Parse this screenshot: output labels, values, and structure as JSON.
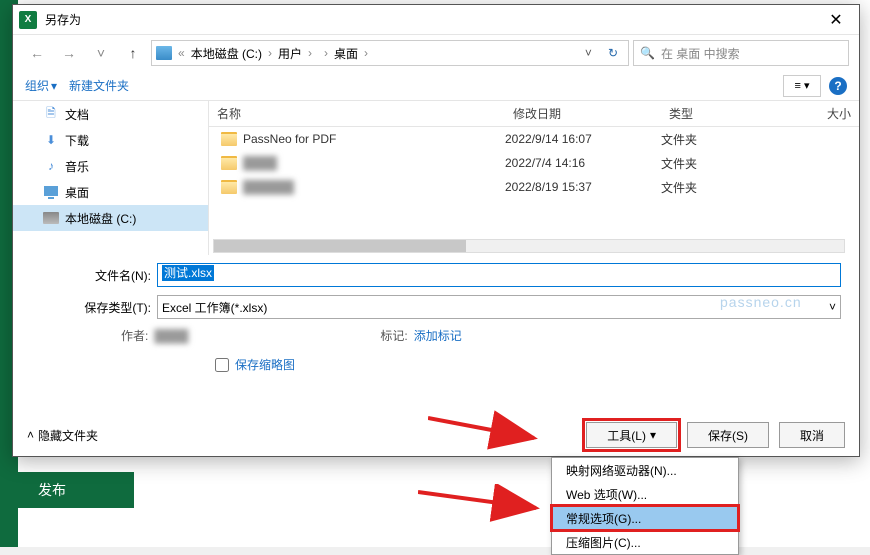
{
  "bg": {
    "publish": "发布"
  },
  "dialog": {
    "title": "另存为",
    "breadcrumb": {
      "drive": "本地磁盘 (C:)",
      "users": "用户",
      "user_hidden": "",
      "desktop": "桌面"
    },
    "search_placeholder": "在 桌面 中搜索",
    "toolbar": {
      "organize": "组织",
      "newfolder": "新建文件夹"
    },
    "sidebar": [
      {
        "label": "文档",
        "icon": "doc"
      },
      {
        "label": "下载",
        "icon": "down"
      },
      {
        "label": "音乐",
        "icon": "music"
      },
      {
        "label": "桌面",
        "icon": "desk"
      },
      {
        "label": "本地磁盘 (C:)",
        "icon": "drive",
        "selected": true
      }
    ],
    "columns": {
      "name": "名称",
      "date": "修改日期",
      "type": "类型",
      "size": "大小"
    },
    "files": [
      {
        "name": "PassNeo for PDF",
        "date": "2022/9/14 16:07",
        "type": "文件夹"
      },
      {
        "name": "",
        "date": "2022/7/4 14:16",
        "type": "文件夹",
        "blur": true
      },
      {
        "name": "",
        "date": "2022/8/19 15:37",
        "type": "文件夹",
        "blur": true
      }
    ],
    "form": {
      "filename_label": "文件名(N):",
      "filename_value": "测试.xlsx",
      "filetype_label": "保存类型(T):",
      "filetype_value": "Excel 工作簿(*.xlsx)",
      "author_label": "作者:",
      "author_value": "",
      "tag_label": "标记:",
      "tag_add": "添加标记",
      "save_thumb": "保存缩略图"
    },
    "footer": {
      "hide": "隐藏文件夹",
      "tools": "工具(L)",
      "save": "保存(S)",
      "cancel": "取消"
    },
    "menu": [
      "映射网络驱动器(N)...",
      "Web 选项(W)...",
      "常规选项(G)...",
      "压缩图片(C)..."
    ]
  },
  "watermark": "passneo.cn"
}
